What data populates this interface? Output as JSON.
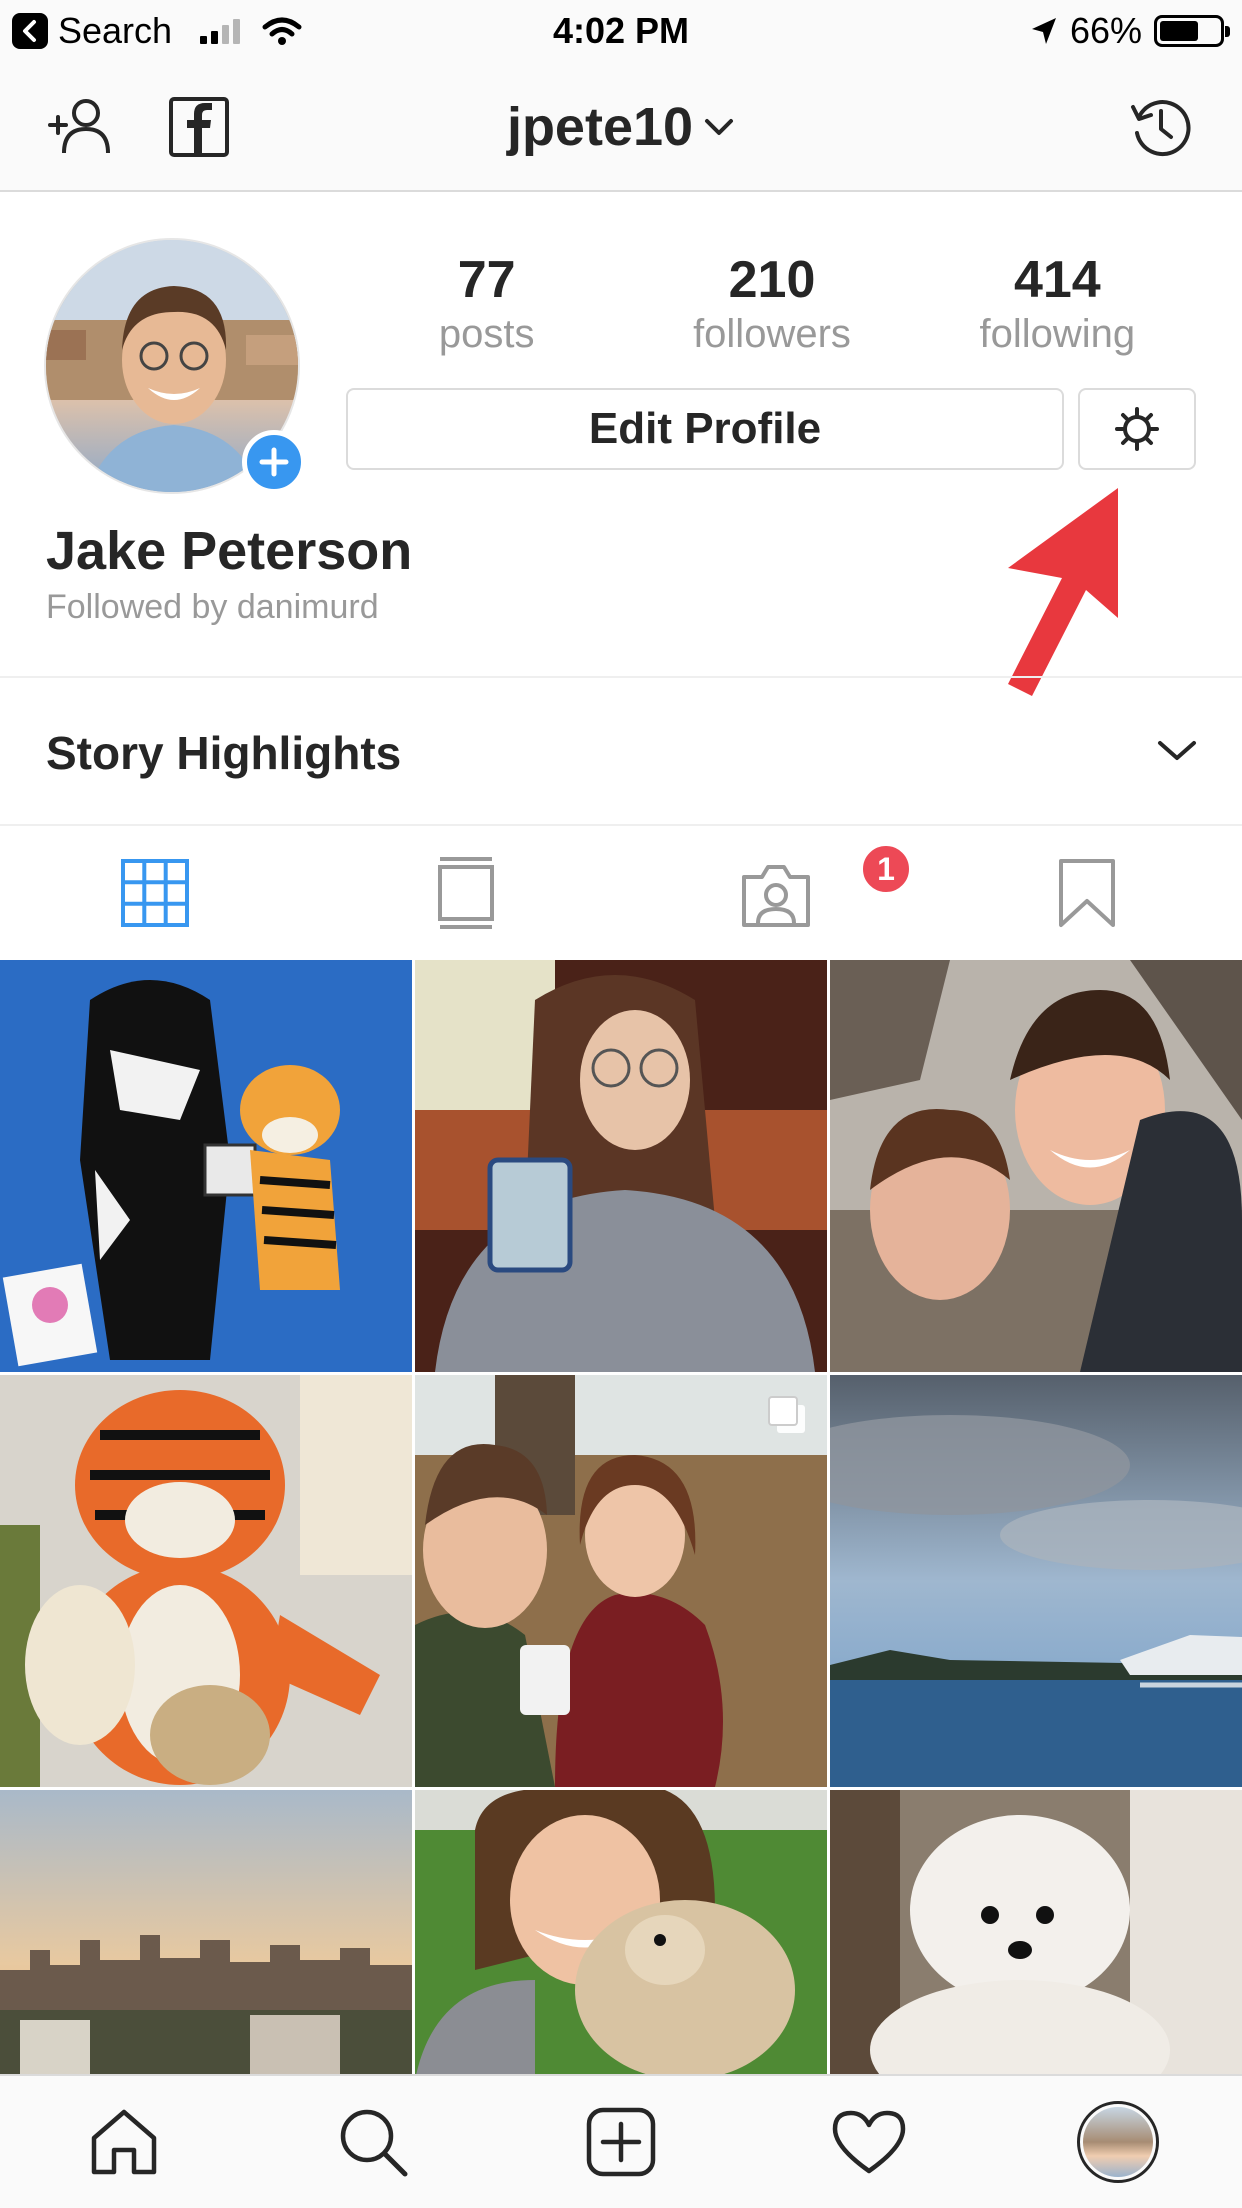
{
  "status_bar": {
    "back_app": "Search",
    "time": "4:02 PM",
    "battery": "66%",
    "battery_level": 0.66,
    "signal_bars": 2
  },
  "nav": {
    "username": "jpete10",
    "icons": [
      "add-person-icon",
      "facebook-icon",
      "chevron-down-icon",
      "history-icon"
    ]
  },
  "profile": {
    "posts_count": "77",
    "posts_label": "posts",
    "followers_count": "210",
    "followers_label": "followers",
    "following_count": "414",
    "following_label": "following",
    "edit_profile_label": "Edit Profile",
    "name": "Jake Peterson",
    "followed_by": "Followed by danimurd"
  },
  "highlights": {
    "title": "Story Highlights"
  },
  "tabs": {
    "active": "grid",
    "tagged_badge": "1",
    "icons": [
      "grid-icon",
      "feed-icon",
      "tagged-icon",
      "saved-icon"
    ]
  },
  "colors": {
    "accent_blue": "#3897f0",
    "badge_red": "#ed4956",
    "arrow_red": "#e8383e",
    "secondary_text": "#999999"
  },
  "bottom_nav": {
    "icons": [
      "home-icon",
      "search-icon",
      "new-post-icon",
      "activity-icon",
      "profile-avatar"
    ]
  }
}
